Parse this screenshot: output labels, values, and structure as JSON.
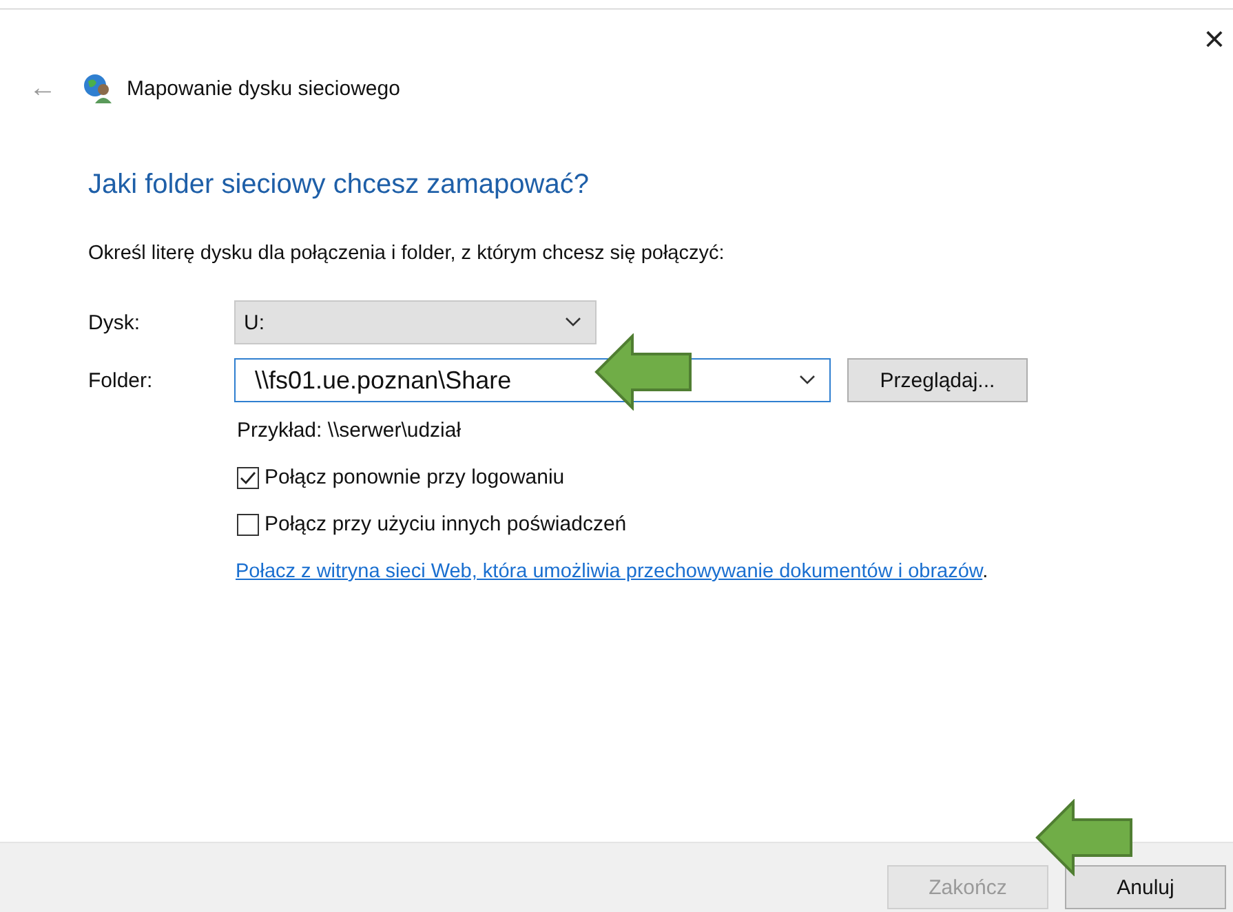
{
  "window": {
    "title": "Mapowanie dysku sieciowego",
    "close": "×",
    "back": "←"
  },
  "heading": "Jaki folder sieciowy chcesz zamapować?",
  "description": "Określ literę dysku dla połączenia i folder, z którym chcesz się połączyć:",
  "drive": {
    "label": "Dysk:",
    "value": "U:"
  },
  "folder": {
    "label": "Folder:",
    "value": "\\\\fs01.ue.poznan\\Share",
    "browse": "Przeglądaj..."
  },
  "example": "Przykład: \\\\serwer\\udział",
  "options": [
    {
      "label": "Połącz ponownie przy logowaniu",
      "checked": true
    },
    {
      "label": "Połącz przy użyciu innych poświadczeń",
      "checked": false
    }
  ],
  "link": "Połacz z witryna sieci Web, która umożliwia przechowywanie dokumentów i obrazów",
  "link_suffix": ".",
  "buttons": [
    {
      "label": "Zakończ",
      "disabled": true
    },
    {
      "label": "Anuluj",
      "disabled": false
    }
  ]
}
